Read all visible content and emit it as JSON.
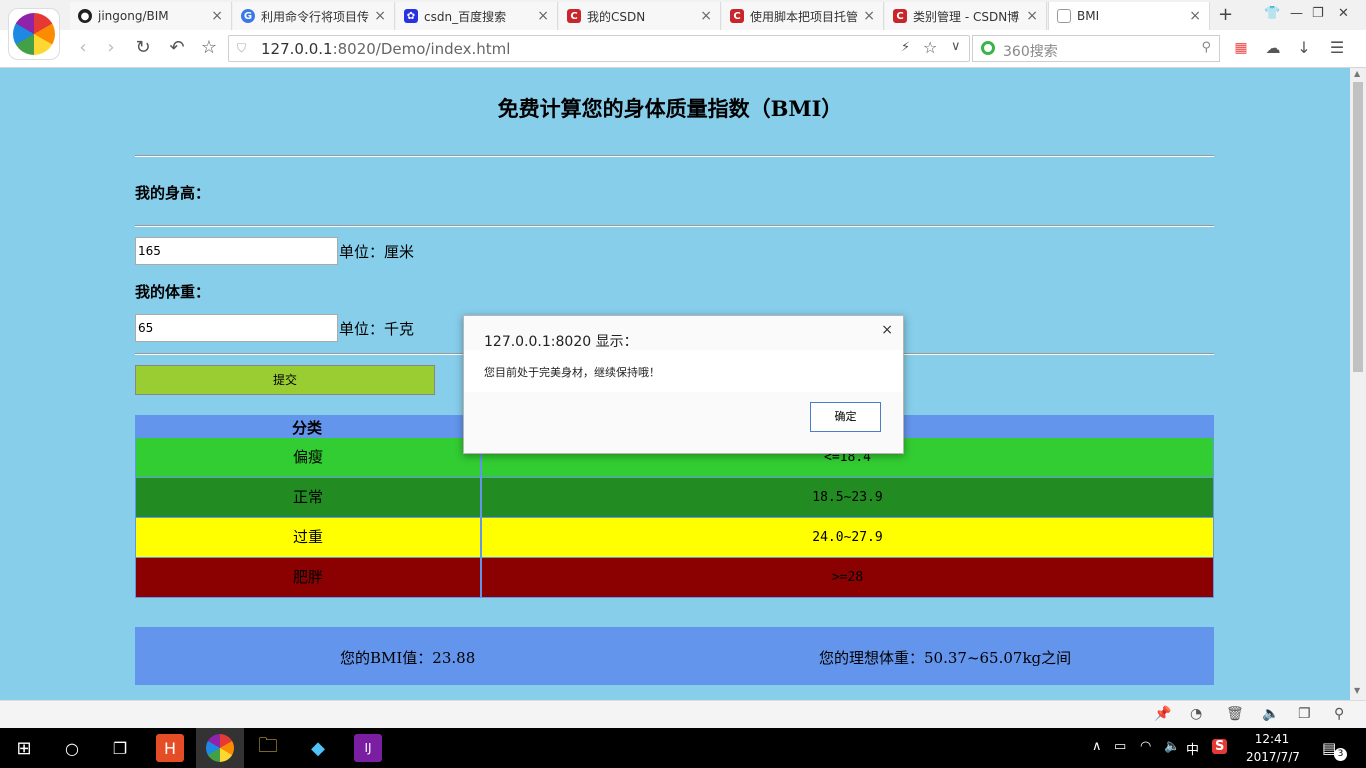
{
  "browser": {
    "tabs": [
      {
        "label": "jingong/BIM",
        "icon": "github-icon"
      },
      {
        "label": "利用命令行将项目传",
        "icon": "google-icon"
      },
      {
        "label": "csdn_百度搜索",
        "icon": "baidu-icon"
      },
      {
        "label": "我的CSDN",
        "icon": "csdn-icon"
      },
      {
        "label": "使用脚本把项目托管",
        "icon": "csdn-icon"
      },
      {
        "label": "类别管理 - CSDN博",
        "icon": "csdn-icon"
      },
      {
        "label": "BMI",
        "icon": "page-icon"
      }
    ],
    "url_host": "127.0.0.1",
    "url_rest": ":8020/Demo/index.html",
    "search_placeholder": "360搜索"
  },
  "page": {
    "title": "免费计算您的身体质量指数（BMI）",
    "height_label": "我的身高：",
    "height_value": "165",
    "height_unit": "单位：厘米",
    "weight_label": "我的体重：",
    "weight_value": "65",
    "weight_unit": "单位：千克",
    "submit_label": "提交",
    "table": {
      "header_category": "分类",
      "rows": [
        {
          "category": "偏瘦",
          "range": "<=18.4",
          "color": "#32cd32"
        },
        {
          "category": "正常",
          "range": "18.5~23.9",
          "color": "#228b22"
        },
        {
          "category": "过重",
          "range": "24.0~27.9",
          "color": "#ffff00"
        },
        {
          "category": "肥胖",
          "range": ">=28",
          "color": "#8b0000"
        }
      ]
    },
    "result_bmi": "您的BMI值：23.88",
    "result_ideal": "您的理想体重：50.37~65.07kg之间"
  },
  "dialog": {
    "title": "127.0.0.1:8020 显示：",
    "message": "您目前处于完美身材，继续保持哦！",
    "ok_label": "确定"
  },
  "taskbar": {
    "time": "12:41",
    "date": "2017/7/7",
    "ime": "中",
    "notification_count": "3"
  }
}
